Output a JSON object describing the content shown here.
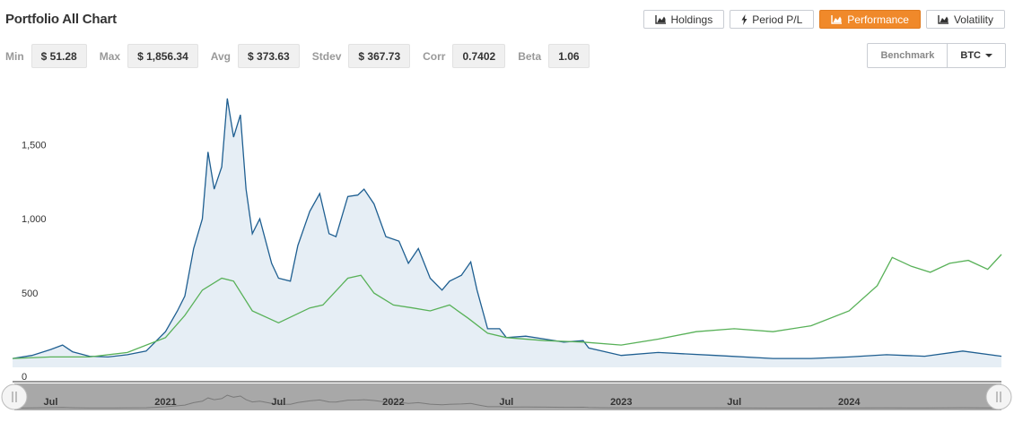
{
  "header": {
    "title": "Portfolio All Chart",
    "tabs": [
      {
        "label": "Holdings",
        "icon": "area-chart-icon",
        "active": false
      },
      {
        "label": "Period P/L",
        "icon": "lightning-icon",
        "active": false
      },
      {
        "label": "Performance",
        "icon": "area-chart-icon",
        "active": true
      },
      {
        "label": "Volatility",
        "icon": "area-chart-icon",
        "active": false
      }
    ]
  },
  "stats": {
    "min_label": "Min",
    "min_value": "$ 51.28",
    "max_label": "Max",
    "max_value": "$ 1,856.34",
    "avg_label": "Avg",
    "avg_value": "$ 373.63",
    "stdev_label": "Stdev",
    "stdev_value": "$ 367.73",
    "corr_label": "Corr",
    "corr_value": "0.7402",
    "beta_label": "Beta",
    "beta_value": "1.06"
  },
  "benchmark": {
    "label": "Benchmark",
    "selected": "BTC"
  },
  "colors": {
    "accent": "#f0892a",
    "portfolio": "#1f5f91",
    "portfolio_fill": "#e6eef5",
    "benchmark": "#58b158"
  },
  "chart_data": {
    "type": "area",
    "title": "",
    "xlabel": "",
    "ylabel": "",
    "x_range": [
      "2020-05",
      "2024-09"
    ],
    "ylim": [
      0,
      1900
    ],
    "y_ticks": [
      0,
      500,
      1000,
      1500
    ],
    "y_tick_labels": [
      "0",
      "500",
      "1,000",
      "1,500"
    ],
    "x_ticks": [
      {
        "label": "Jul",
        "date": "2020-07"
      },
      {
        "label": "2021",
        "date": "2021-01"
      },
      {
        "label": "Jul",
        "date": "2021-07"
      },
      {
        "label": "2022",
        "date": "2022-01"
      },
      {
        "label": "Jul",
        "date": "2022-07"
      },
      {
        "label": "2023",
        "date": "2023-01"
      },
      {
        "label": "Jul",
        "date": "2023-07"
      },
      {
        "label": "2024",
        "date": "2024-01"
      }
    ],
    "grid": false,
    "series": [
      {
        "key": "portfolio",
        "style": "area",
        "points": [
          [
            "2020-05-01",
            60
          ],
          [
            "2020-06-01",
            80
          ],
          [
            "2020-07-01",
            120
          ],
          [
            "2020-07-20",
            150
          ],
          [
            "2020-08-05",
            105
          ],
          [
            "2020-09-01",
            75
          ],
          [
            "2020-10-01",
            70
          ],
          [
            "2020-11-01",
            85
          ],
          [
            "2020-12-01",
            110
          ],
          [
            "2021-01-01",
            240
          ],
          [
            "2021-01-20",
            380
          ],
          [
            "2021-02-01",
            480
          ],
          [
            "2021-02-15",
            800
          ],
          [
            "2021-03-01",
            1000
          ],
          [
            "2021-03-10",
            1450
          ],
          [
            "2021-03-20",
            1200
          ],
          [
            "2021-04-01",
            1350
          ],
          [
            "2021-04-10",
            1810
          ],
          [
            "2021-04-20",
            1550
          ],
          [
            "2021-05-01",
            1700
          ],
          [
            "2021-05-10",
            1200
          ],
          [
            "2021-05-20",
            900
          ],
          [
            "2021-06-01",
            1000
          ],
          [
            "2021-06-20",
            700
          ],
          [
            "2021-07-01",
            600
          ],
          [
            "2021-07-20",
            580
          ],
          [
            "2021-08-01",
            820
          ],
          [
            "2021-08-20",
            1050
          ],
          [
            "2021-09-05",
            1170
          ],
          [
            "2021-09-20",
            900
          ],
          [
            "2021-10-01",
            880
          ],
          [
            "2021-10-20",
            1150
          ],
          [
            "2021-11-05",
            1160
          ],
          [
            "2021-11-15",
            1200
          ],
          [
            "2021-12-01",
            1100
          ],
          [
            "2021-12-20",
            880
          ],
          [
            "2022-01-10",
            850
          ],
          [
            "2022-01-25",
            700
          ],
          [
            "2022-02-10",
            800
          ],
          [
            "2022-03-01",
            600
          ],
          [
            "2022-03-20",
            520
          ],
          [
            "2022-04-01",
            580
          ],
          [
            "2022-04-20",
            620
          ],
          [
            "2022-05-05",
            710
          ],
          [
            "2022-05-15",
            520
          ],
          [
            "2022-06-01",
            260
          ],
          [
            "2022-06-20",
            260
          ],
          [
            "2022-07-01",
            200
          ],
          [
            "2022-08-01",
            210
          ],
          [
            "2022-09-01",
            190
          ],
          [
            "2022-10-01",
            170
          ],
          [
            "2022-11-01",
            180
          ],
          [
            "2022-11-10",
            130
          ],
          [
            "2022-12-01",
            110
          ],
          [
            "2023-01-01",
            80
          ],
          [
            "2023-03-01",
            100
          ],
          [
            "2023-06-01",
            80
          ],
          [
            "2023-09-01",
            60
          ],
          [
            "2023-11-01",
            60
          ],
          [
            "2024-01-01",
            70
          ],
          [
            "2024-03-01",
            85
          ],
          [
            "2024-05-01",
            75
          ],
          [
            "2024-07-01",
            110
          ],
          [
            "2024-09-01",
            75
          ]
        ]
      },
      {
        "key": "benchmark",
        "style": "line",
        "points": [
          [
            "2020-05-01",
            60
          ],
          [
            "2020-07-01",
            70
          ],
          [
            "2020-09-01",
            70
          ],
          [
            "2020-11-01",
            100
          ],
          [
            "2021-01-01",
            200
          ],
          [
            "2021-02-01",
            350
          ],
          [
            "2021-03-01",
            520
          ],
          [
            "2021-04-01",
            600
          ],
          [
            "2021-04-20",
            580
          ],
          [
            "2021-05-20",
            380
          ],
          [
            "2021-07-01",
            300
          ],
          [
            "2021-08-20",
            400
          ],
          [
            "2021-09-10",
            420
          ],
          [
            "2021-10-20",
            600
          ],
          [
            "2021-11-10",
            620
          ],
          [
            "2021-12-01",
            500
          ],
          [
            "2022-01-01",
            420
          ],
          [
            "2022-02-01",
            400
          ],
          [
            "2022-03-01",
            380
          ],
          [
            "2022-04-01",
            420
          ],
          [
            "2022-05-01",
            330
          ],
          [
            "2022-06-01",
            230
          ],
          [
            "2022-07-01",
            200
          ],
          [
            "2022-09-01",
            180
          ],
          [
            "2022-11-01",
            170
          ],
          [
            "2023-01-01",
            150
          ],
          [
            "2023-03-01",
            190
          ],
          [
            "2023-05-01",
            240
          ],
          [
            "2023-07-01",
            260
          ],
          [
            "2023-09-01",
            240
          ],
          [
            "2023-11-01",
            280
          ],
          [
            "2024-01-01",
            380
          ],
          [
            "2024-02-15",
            550
          ],
          [
            "2024-03-10",
            740
          ],
          [
            "2024-04-10",
            680
          ],
          [
            "2024-05-10",
            640
          ],
          [
            "2024-06-10",
            700
          ],
          [
            "2024-07-10",
            720
          ],
          [
            "2024-08-10",
            660
          ],
          [
            "2024-09-01",
            760
          ]
        ]
      }
    ]
  }
}
